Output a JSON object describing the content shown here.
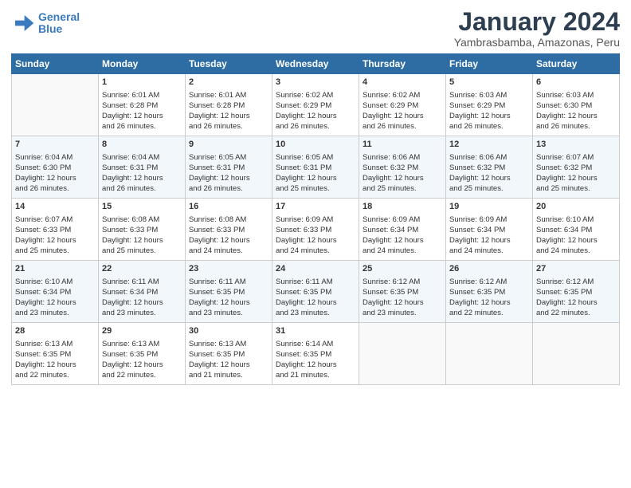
{
  "header": {
    "logo_line1": "General",
    "logo_line2": "Blue",
    "title": "January 2024",
    "subtitle": "Yambrasbamba, Amazonas, Peru"
  },
  "columns": [
    "Sunday",
    "Monday",
    "Tuesday",
    "Wednesday",
    "Thursday",
    "Friday",
    "Saturday"
  ],
  "weeks": [
    [
      {
        "day": "",
        "content": ""
      },
      {
        "day": "1",
        "content": "Sunrise: 6:01 AM\nSunset: 6:28 PM\nDaylight: 12 hours\nand 26 minutes."
      },
      {
        "day": "2",
        "content": "Sunrise: 6:01 AM\nSunset: 6:28 PM\nDaylight: 12 hours\nand 26 minutes."
      },
      {
        "day": "3",
        "content": "Sunrise: 6:02 AM\nSunset: 6:29 PM\nDaylight: 12 hours\nand 26 minutes."
      },
      {
        "day": "4",
        "content": "Sunrise: 6:02 AM\nSunset: 6:29 PM\nDaylight: 12 hours\nand 26 minutes."
      },
      {
        "day": "5",
        "content": "Sunrise: 6:03 AM\nSunset: 6:29 PM\nDaylight: 12 hours\nand 26 minutes."
      },
      {
        "day": "6",
        "content": "Sunrise: 6:03 AM\nSunset: 6:30 PM\nDaylight: 12 hours\nand 26 minutes."
      }
    ],
    [
      {
        "day": "7",
        "content": "Sunrise: 6:04 AM\nSunset: 6:30 PM\nDaylight: 12 hours\nand 26 minutes."
      },
      {
        "day": "8",
        "content": "Sunrise: 6:04 AM\nSunset: 6:31 PM\nDaylight: 12 hours\nand 26 minutes."
      },
      {
        "day": "9",
        "content": "Sunrise: 6:05 AM\nSunset: 6:31 PM\nDaylight: 12 hours\nand 26 minutes."
      },
      {
        "day": "10",
        "content": "Sunrise: 6:05 AM\nSunset: 6:31 PM\nDaylight: 12 hours\nand 25 minutes."
      },
      {
        "day": "11",
        "content": "Sunrise: 6:06 AM\nSunset: 6:32 PM\nDaylight: 12 hours\nand 25 minutes."
      },
      {
        "day": "12",
        "content": "Sunrise: 6:06 AM\nSunset: 6:32 PM\nDaylight: 12 hours\nand 25 minutes."
      },
      {
        "day": "13",
        "content": "Sunrise: 6:07 AM\nSunset: 6:32 PM\nDaylight: 12 hours\nand 25 minutes."
      }
    ],
    [
      {
        "day": "14",
        "content": "Sunrise: 6:07 AM\nSunset: 6:33 PM\nDaylight: 12 hours\nand 25 minutes."
      },
      {
        "day": "15",
        "content": "Sunrise: 6:08 AM\nSunset: 6:33 PM\nDaylight: 12 hours\nand 25 minutes."
      },
      {
        "day": "16",
        "content": "Sunrise: 6:08 AM\nSunset: 6:33 PM\nDaylight: 12 hours\nand 24 minutes."
      },
      {
        "day": "17",
        "content": "Sunrise: 6:09 AM\nSunset: 6:33 PM\nDaylight: 12 hours\nand 24 minutes."
      },
      {
        "day": "18",
        "content": "Sunrise: 6:09 AM\nSunset: 6:34 PM\nDaylight: 12 hours\nand 24 minutes."
      },
      {
        "day": "19",
        "content": "Sunrise: 6:09 AM\nSunset: 6:34 PM\nDaylight: 12 hours\nand 24 minutes."
      },
      {
        "day": "20",
        "content": "Sunrise: 6:10 AM\nSunset: 6:34 PM\nDaylight: 12 hours\nand 24 minutes."
      }
    ],
    [
      {
        "day": "21",
        "content": "Sunrise: 6:10 AM\nSunset: 6:34 PM\nDaylight: 12 hours\nand 23 minutes."
      },
      {
        "day": "22",
        "content": "Sunrise: 6:11 AM\nSunset: 6:34 PM\nDaylight: 12 hours\nand 23 minutes."
      },
      {
        "day": "23",
        "content": "Sunrise: 6:11 AM\nSunset: 6:35 PM\nDaylight: 12 hours\nand 23 minutes."
      },
      {
        "day": "24",
        "content": "Sunrise: 6:11 AM\nSunset: 6:35 PM\nDaylight: 12 hours\nand 23 minutes."
      },
      {
        "day": "25",
        "content": "Sunrise: 6:12 AM\nSunset: 6:35 PM\nDaylight: 12 hours\nand 23 minutes."
      },
      {
        "day": "26",
        "content": "Sunrise: 6:12 AM\nSunset: 6:35 PM\nDaylight: 12 hours\nand 22 minutes."
      },
      {
        "day": "27",
        "content": "Sunrise: 6:12 AM\nSunset: 6:35 PM\nDaylight: 12 hours\nand 22 minutes."
      }
    ],
    [
      {
        "day": "28",
        "content": "Sunrise: 6:13 AM\nSunset: 6:35 PM\nDaylight: 12 hours\nand 22 minutes."
      },
      {
        "day": "29",
        "content": "Sunrise: 6:13 AM\nSunset: 6:35 PM\nDaylight: 12 hours\nand 22 minutes."
      },
      {
        "day": "30",
        "content": "Sunrise: 6:13 AM\nSunset: 6:35 PM\nDaylight: 12 hours\nand 21 minutes."
      },
      {
        "day": "31",
        "content": "Sunrise: 6:14 AM\nSunset: 6:35 PM\nDaylight: 12 hours\nand 21 minutes."
      },
      {
        "day": "",
        "content": ""
      },
      {
        "day": "",
        "content": ""
      },
      {
        "day": "",
        "content": ""
      }
    ]
  ]
}
